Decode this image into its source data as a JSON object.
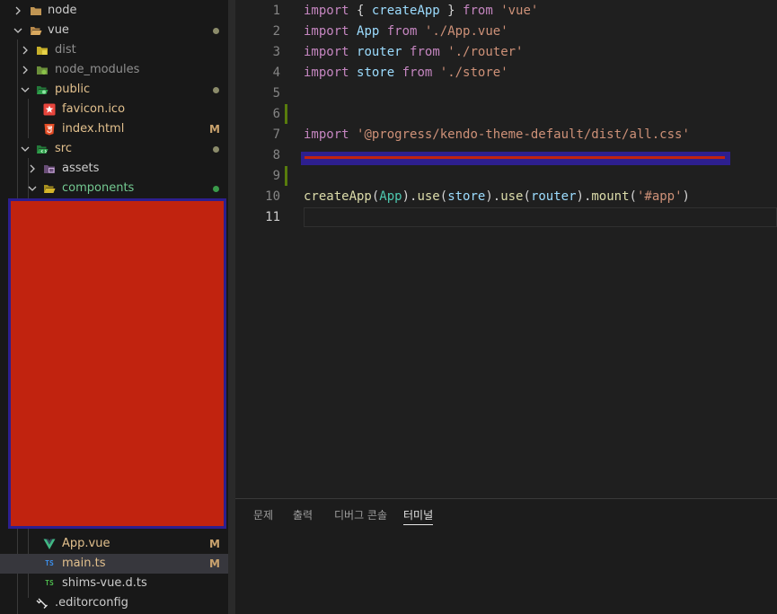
{
  "explorer": {
    "items": [
      {
        "label": "node",
        "kind": "folder",
        "color": "#c09553"
      },
      {
        "label": "vue",
        "kind": "folder-open",
        "color": "#c09553",
        "status": "dot"
      },
      {
        "label": "dist",
        "kind": "folder",
        "color": "#c7b02a"
      },
      {
        "label": "node_modules",
        "kind": "folder",
        "color": "#8bc34a"
      },
      {
        "label": "public",
        "kind": "folder-open",
        "color": "#2e9e4a",
        "status": "dot"
      },
      {
        "label": "favicon.ico",
        "kind": "file",
        "icon": "star-icon"
      },
      {
        "label": "index.html",
        "kind": "file",
        "icon": "html5-icon"
      },
      {
        "label": "src",
        "kind": "folder-open",
        "color": "#2e9e4a",
        "status": "dot"
      },
      {
        "label": "assets",
        "kind": "folder",
        "color": "#7a5a8a"
      },
      {
        "label": "components",
        "kind": "folder-open",
        "color": "#c7b02a",
        "status": "dot-green"
      },
      {
        "label": "App.vue",
        "kind": "file",
        "icon": "vue-icon",
        "badge": "M"
      },
      {
        "label": "main.ts",
        "kind": "file",
        "icon": "typescript-icon",
        "badge": "M"
      },
      {
        "label": "shims-vue.d.ts",
        "kind": "file",
        "icon": "typescript-def-icon"
      },
      {
        "label": ".editorconfig",
        "kind": "file",
        "icon": "editorconfig-icon"
      }
    ],
    "badge_modified": "M",
    "ts_icon_text": "TS"
  },
  "editor": {
    "line_numbers": [
      "1",
      "2",
      "3",
      "4",
      "5",
      "6",
      "7",
      "8",
      "9",
      "10",
      "11"
    ],
    "lines": [
      [
        {
          "t": "import",
          "c": "k"
        },
        {
          "t": " { ",
          "c": "p"
        },
        {
          "t": "createApp",
          "c": "v"
        },
        {
          "t": " } ",
          "c": "p"
        },
        {
          "t": "from",
          "c": "k"
        },
        {
          "t": " ",
          "c": "p"
        },
        {
          "t": "'vue'",
          "c": "s"
        }
      ],
      [
        {
          "t": "import",
          "c": "k"
        },
        {
          "t": " ",
          "c": "p"
        },
        {
          "t": "App",
          "c": "v"
        },
        {
          "t": " ",
          "c": "p"
        },
        {
          "t": "from",
          "c": "k"
        },
        {
          "t": " ",
          "c": "p"
        },
        {
          "t": "'./App.vue'",
          "c": "s"
        }
      ],
      [
        {
          "t": "import",
          "c": "k"
        },
        {
          "t": " ",
          "c": "p"
        },
        {
          "t": "router",
          "c": "v"
        },
        {
          "t": " ",
          "c": "p"
        },
        {
          "t": "from",
          "c": "k"
        },
        {
          "t": " ",
          "c": "p"
        },
        {
          "t": "'./router'",
          "c": "s"
        }
      ],
      [
        {
          "t": "import",
          "c": "k"
        },
        {
          "t": " ",
          "c": "p"
        },
        {
          "t": "store",
          "c": "v"
        },
        {
          "t": " ",
          "c": "p"
        },
        {
          "t": "from",
          "c": "k"
        },
        {
          "t": " ",
          "c": "p"
        },
        {
          "t": "'./store'",
          "c": "s"
        }
      ],
      [],
      [],
      [
        {
          "t": "import",
          "c": "k"
        },
        {
          "t": " ",
          "c": "p"
        },
        {
          "t": "'@progress/kendo-theme-default/dist/all.css'",
          "c": "s"
        }
      ],
      [],
      [],
      [
        {
          "t": "createApp",
          "c": "f"
        },
        {
          "t": "(",
          "c": "p"
        },
        {
          "t": "App",
          "c": "c"
        },
        {
          "t": ").",
          "c": "p"
        },
        {
          "t": "use",
          "c": "f"
        },
        {
          "t": "(",
          "c": "p"
        },
        {
          "t": "store",
          "c": "v"
        },
        {
          "t": ").",
          "c": "p"
        },
        {
          "t": "use",
          "c": "f"
        },
        {
          "t": "(",
          "c": "p"
        },
        {
          "t": "router",
          "c": "v"
        },
        {
          "t": ").",
          "c": "p"
        },
        {
          "t": "mount",
          "c": "f"
        },
        {
          "t": "(",
          "c": "p"
        },
        {
          "t": "'#app'",
          "c": "s"
        },
        {
          "t": ")",
          "c": "p"
        }
      ],
      []
    ],
    "active_line": "11"
  },
  "panel": {
    "tabs": [
      "문제",
      "출력",
      "디버그 콘솔",
      "터미널"
    ],
    "active_tab": "터미널"
  },
  "colors": {
    "redaction_fill": "#c1230f",
    "redaction_border": "#2d1f8f"
  }
}
